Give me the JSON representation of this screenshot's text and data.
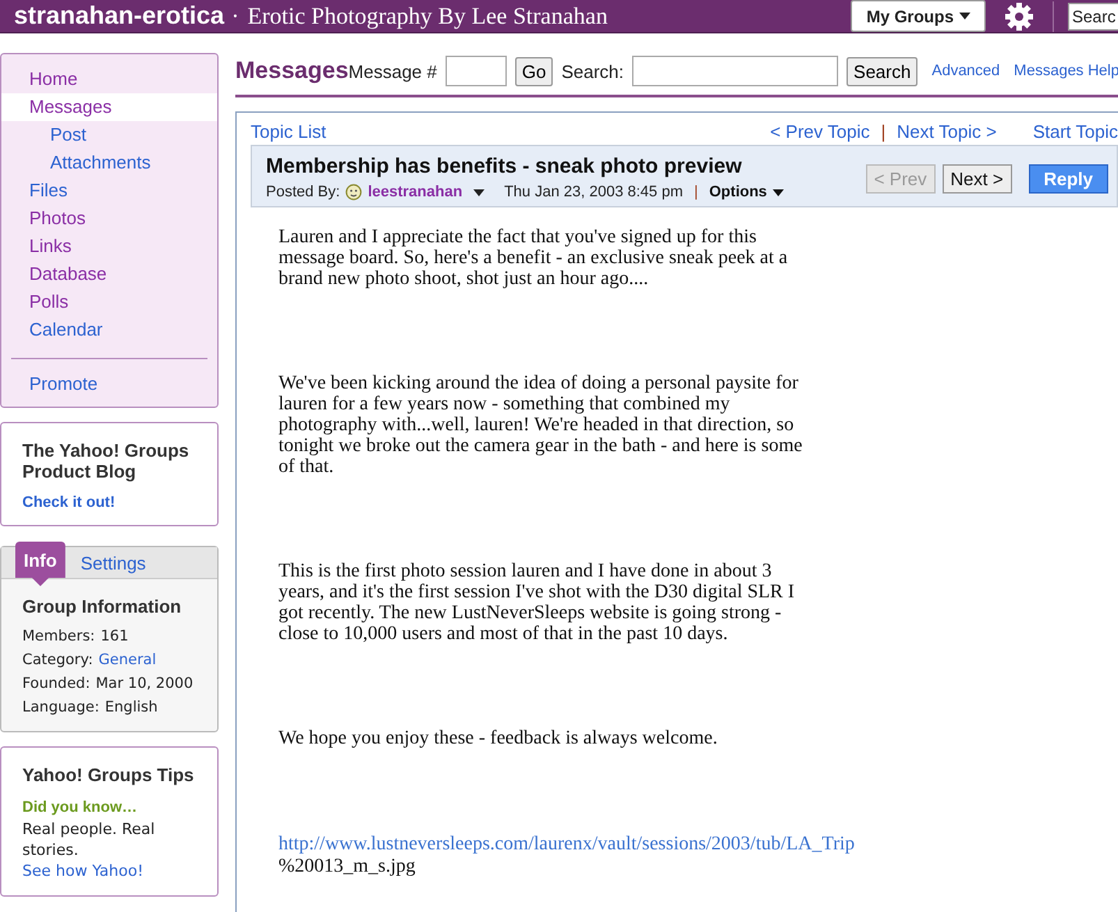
{
  "header": {
    "group_name": "stranahan-erotica",
    "separator": "·",
    "tagline": "Erotic Photography By Lee Stranahan",
    "my_groups": "My Groups",
    "search_placeholder": "Searc"
  },
  "sidebar": {
    "items": [
      {
        "label": "Home",
        "selected": false,
        "visited": true
      },
      {
        "label": "Messages",
        "selected": true,
        "visited": true,
        "children": [
          {
            "label": "Post",
            "selected": false,
            "visited": false
          },
          {
            "label": "Attachments",
            "selected": false,
            "visited": false
          }
        ]
      },
      {
        "label": "Files",
        "selected": false,
        "visited": false
      },
      {
        "label": "Photos",
        "selected": false,
        "visited": true
      },
      {
        "label": "Links",
        "selected": false,
        "visited": true
      },
      {
        "label": "Database",
        "selected": false,
        "visited": true
      },
      {
        "label": "Polls",
        "selected": false,
        "visited": true
      },
      {
        "label": "Calendar",
        "selected": false,
        "visited": false
      }
    ],
    "promote": "Promote",
    "blog": {
      "title": "The Yahoo! Groups Product Blog",
      "link": "Check it out!"
    },
    "info": {
      "tabs": [
        {
          "label": "Info",
          "selected": true
        },
        {
          "label": "Settings",
          "selected": false
        }
      ],
      "title": "Group Information",
      "rows": [
        {
          "label": "Members:",
          "value": "161",
          "kind": "text"
        },
        {
          "label": "Category:",
          "value": "General",
          "kind": "link"
        },
        {
          "label": "Founded:",
          "value": "Mar 10, 2000",
          "kind": "text"
        },
        {
          "label": "Language:",
          "value": "English",
          "kind": "text"
        }
      ]
    },
    "tips": {
      "title": "Yahoo! Groups Tips",
      "subtitle": "Did you know…",
      "text": "Real people. Real stories.",
      "link": "See how Yahoo!"
    }
  },
  "toolbar": {
    "title": "Messages",
    "message_label": "Message #",
    "go": "Go",
    "search_label": "Search:",
    "search_button": "Search",
    "links": [
      "Advanced",
      "Messages Help"
    ]
  },
  "message": {
    "topic_list": "Topic List",
    "prev_topic": "< Prev Topic",
    "divider": "|",
    "next_topic": "Next Topic >",
    "start_topic": "Start Topic",
    "title": "Membership has benefits - sneak photo preview",
    "posted_by": "Posted By:",
    "author": "leestranahan",
    "date": "Thu Jan 23, 2003 8:45 pm",
    "options": "Options",
    "buttons": [
      {
        "label": "< Prev",
        "kind": "nav",
        "disabled": true
      },
      {
        "label": "Next >",
        "kind": "nav",
        "disabled": false
      },
      {
        "label": "Reply",
        "kind": "primary"
      }
    ],
    "paragraphs": [
      "Lauren and I appreciate the fact that you've signed up for this message board. So, here's a benefit - an exclusive sneak peek at a brand new photo shoot, shot just an hour ago....",
      "We've been kicking around the idea of doing a personal paysite for lauren for a few years now - something that combined my photography with...well, lauren! We're headed in that direction, so tonight we broke out the camera gear in the bath - and here is some of that.",
      "This is the first photo session lauren and I have done in about 3 years, and it's the first session I've shot with the D30 digital SLR I got recently. The new LustNeverSleeps website is going strong - close to 10,000 users and most of that in the past 10 days.",
      "We hope you enjoy these - feedback is always welcome."
    ],
    "url": "http://www.lustneversleeps.com/laurenx/vault/sessions/2003/tub/LA_Trip",
    "url_rest": "%20013_m_s.jpg"
  }
}
